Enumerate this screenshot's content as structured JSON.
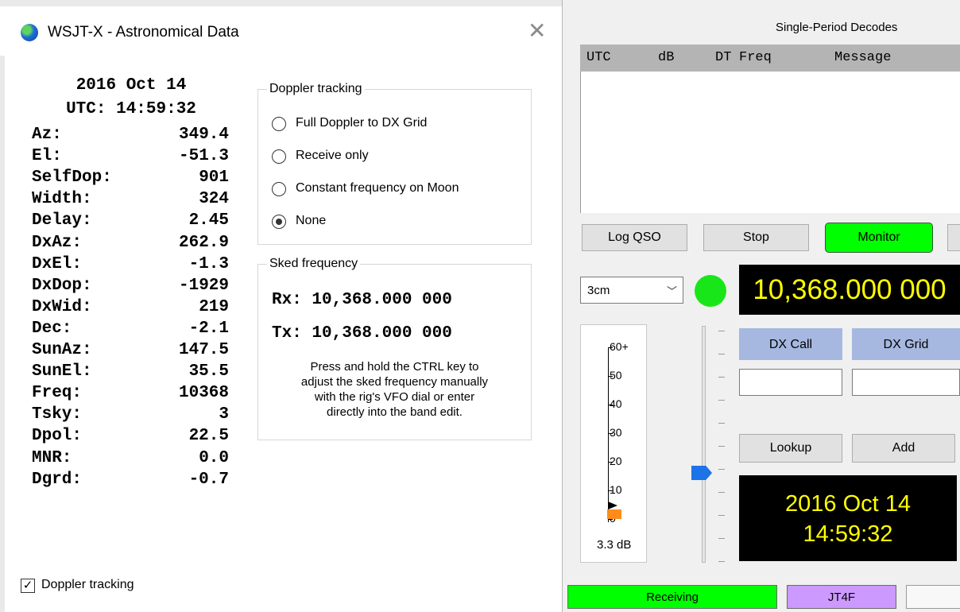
{
  "astro": {
    "title": "WSJT-X - Astronomical Data",
    "close_glyph": "✕",
    "date": "2016 Oct 14",
    "utc": "UTC: 14:59:32",
    "rows": [
      {
        "label": "Az:",
        "value": "349.4"
      },
      {
        "label": "El:",
        "value": "-51.3"
      },
      {
        "label": "SelfDop:",
        "value": "901"
      },
      {
        "label": "Width:",
        "value": "324"
      },
      {
        "label": "Delay:",
        "value": "2.45"
      },
      {
        "label": "DxAz:",
        "value": "262.9"
      },
      {
        "label": "DxEl:",
        "value": "-1.3"
      },
      {
        "label": "DxDop:",
        "value": "-1929"
      },
      {
        "label": "DxWid:",
        "value": "219"
      },
      {
        "label": "Dec:",
        "value": "-2.1"
      },
      {
        "label": "SunAz:",
        "value": "147.5"
      },
      {
        "label": "SunEl:",
        "value": "35.5"
      },
      {
        "label": "Freq:",
        "value": "10368"
      },
      {
        "label": "Tsky:",
        "value": "3"
      },
      {
        "label": "Dpol:",
        "value": "22.5"
      },
      {
        "label": "MNR:",
        "value": "0.0"
      },
      {
        "label": "Dgrd:",
        "value": "-0.7"
      }
    ],
    "doppler_group": {
      "title": "Doppler tracking",
      "options": [
        {
          "label": "Full Doppler to DX Grid",
          "selected": false
        },
        {
          "label": "Receive only",
          "selected": false
        },
        {
          "label": "Constant frequency on Moon",
          "selected": false
        },
        {
          "label": "None",
          "selected": true
        }
      ]
    },
    "sked_group": {
      "title": "Sked frequency",
      "rx": "Rx: 10,368.000 000",
      "tx": "Tx: 10,368.000 000",
      "note_lines": [
        "Press and hold the CTRL key to",
        "adjust the sked frequency manually",
        "with the rig's VFO dial or enter",
        "directly into the band edit."
      ]
    },
    "doppler_checkbox": {
      "label": "Doppler tracking",
      "checked": true
    }
  },
  "main": {
    "decodes_title": "Single-Period Decodes",
    "decode_headers": [
      "UTC",
      "dB",
      "DT",
      "Freq",
      "Message"
    ],
    "buttons": {
      "log_qso": "Log QSO",
      "stop": "Stop",
      "monitor": "Monitor",
      "lookup": "Lookup",
      "add": "Add"
    },
    "band": "3cm",
    "dial_freq": "10,368.000 000",
    "dx_call_label": "DX Call",
    "dx_grid_label": "DX Grid",
    "dx_call_value": "",
    "dx_grid_value": "",
    "meter": {
      "ticks": [
        "60+",
        "50",
        "40",
        "30",
        "20",
        "10",
        "0"
      ],
      "reading": "3.3 dB",
      "level_db": 3.3
    },
    "clock_date": "2016 Oct 14",
    "clock_time": "14:59:32",
    "status": {
      "state": "Receiving",
      "mode": "JT4F"
    },
    "colors": {
      "monitor": "#00ff00",
      "receiving": "#00ff00",
      "mode": "#cc99ff",
      "lcd_text": "#ffff00",
      "indicator": "#19e619",
      "blue_btn": "#a6b8e0",
      "slider": "#1e73e8"
    }
  }
}
